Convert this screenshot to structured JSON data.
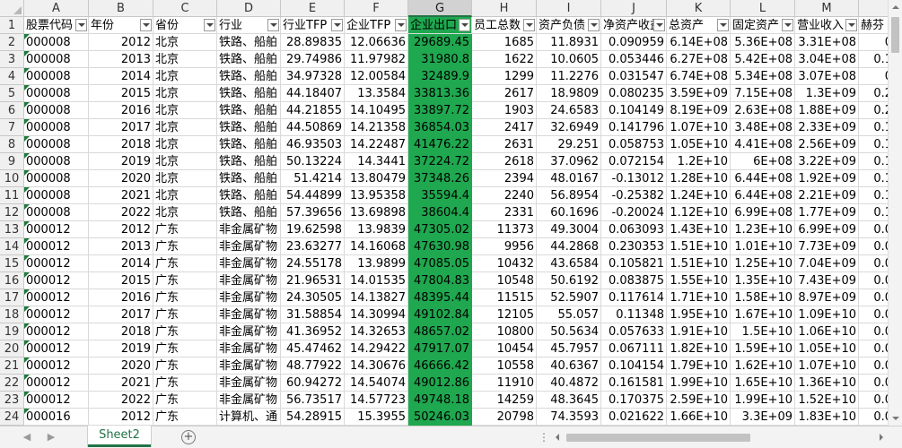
{
  "columns": [
    "A",
    "B",
    "C",
    "D",
    "E",
    "F",
    "G",
    "H",
    "I",
    "J",
    "K",
    "L",
    "M",
    ""
  ],
  "selected_column": "G",
  "headers": [
    "股票代码",
    "年份",
    "省份",
    "行业",
    "行业TFP",
    "企业TFP",
    "企业出口",
    "员工总数",
    "资产负债",
    "净资产收益",
    "总资产",
    "固定资产",
    "营业收入",
    "赫芬"
  ],
  "rows": [
    {
      "n": "2",
      "v": [
        "000008",
        "2012",
        "北京",
        "铁路、船舶",
        "28.89835",
        "12.06636",
        "29689.45",
        "1685",
        "11.8931",
        "0.090959",
        "6.14E+08",
        "5.36E+08",
        "3.31E+08",
        "0"
      ]
    },
    {
      "n": "3",
      "v": [
        "000008",
        "2013",
        "北京",
        "铁路、船舶",
        "29.74986",
        "11.97982",
        "31980.8",
        "1622",
        "10.0605",
        "0.053446",
        "6.27E+08",
        "5.42E+08",
        "3.04E+08",
        "0.1"
      ]
    },
    {
      "n": "4",
      "v": [
        "000008",
        "2014",
        "北京",
        "铁路、船舶",
        "34.97328",
        "12.00584",
        "32489.9",
        "1299",
        "11.2276",
        "0.031547",
        "6.74E+08",
        "5.34E+08",
        "3.07E+08",
        "0"
      ]
    },
    {
      "n": "5",
      "v": [
        "000008",
        "2015",
        "北京",
        "铁路、船舶",
        "44.18407",
        "13.3584",
        "33813.36",
        "2617",
        "18.9809",
        "0.080235",
        "3.59E+09",
        "7.15E+08",
        "1.3E+09",
        "0.2"
      ]
    },
    {
      "n": "6",
      "v": [
        "000008",
        "2016",
        "北京",
        "铁路、船舶",
        "44.21855",
        "14.10495",
        "33897.72",
        "1903",
        "24.6583",
        "0.104149",
        "8.19E+09",
        "2.63E+08",
        "1.88E+09",
        "0.2"
      ]
    },
    {
      "n": "7",
      "v": [
        "000008",
        "2017",
        "北京",
        "铁路、船舶",
        "44.50869",
        "14.21358",
        "36854.03",
        "2417",
        "32.6949",
        "0.141796",
        "1.07E+10",
        "3.48E+08",
        "2.33E+09",
        "0.1"
      ]
    },
    {
      "n": "8",
      "v": [
        "000008",
        "2018",
        "北京",
        "铁路、船舶",
        "46.93503",
        "14.22487",
        "41476.22",
        "2631",
        "29.251",
        "0.058753",
        "1.05E+10",
        "4.41E+08",
        "2.56E+09",
        "0.1"
      ]
    },
    {
      "n": "9",
      "v": [
        "000008",
        "2019",
        "北京",
        "铁路、船舶",
        "50.13224",
        "14.3441",
        "37224.72",
        "2618",
        "37.0962",
        "0.072154",
        "1.2E+10",
        "6E+08",
        "3.22E+09",
        "0.1"
      ]
    },
    {
      "n": "10",
      "v": [
        "000008",
        "2020",
        "北京",
        "铁路、船舶",
        "51.4214",
        "13.80479",
        "37348.26",
        "2394",
        "48.0167",
        "-0.13012",
        "1.28E+10",
        "6.44E+08",
        "1.92E+09",
        "0.1"
      ]
    },
    {
      "n": "11",
      "v": [
        "000008",
        "2021",
        "北京",
        "铁路、船舶",
        "54.44899",
        "13.95358",
        "35594.4",
        "2240",
        "56.8954",
        "-0.25382",
        "1.24E+10",
        "6.44E+08",
        "2.21E+09",
        "0.1"
      ]
    },
    {
      "n": "12",
      "v": [
        "000008",
        "2022",
        "北京",
        "铁路、船舶",
        "57.39656",
        "13.69898",
        "38604.4",
        "2331",
        "60.1696",
        "-0.20024",
        "1.12E+10",
        "6.99E+08",
        "1.77E+09",
        "0.1"
      ]
    },
    {
      "n": "13",
      "v": [
        "000012",
        "2012",
        "广东",
        "非金属矿物",
        "19.62598",
        "13.9839",
        "47305.02",
        "11373",
        "49.3004",
        "0.063093",
        "1.43E+10",
        "1.23E+10",
        "6.99E+09",
        "0.0"
      ]
    },
    {
      "n": "14",
      "v": [
        "000012",
        "2013",
        "广东",
        "非金属矿物",
        "23.63277",
        "14.16068",
        "47630.98",
        "9956",
        "44.2868",
        "0.230353",
        "1.51E+10",
        "1.01E+10",
        "7.73E+09",
        "0.0"
      ]
    },
    {
      "n": "15",
      "v": [
        "000012",
        "2014",
        "广东",
        "非金属矿物",
        "24.55178",
        "13.9899",
        "47085.05",
        "10432",
        "43.6584",
        "0.105821",
        "1.51E+10",
        "1.25E+10",
        "7.04E+09",
        "0.0"
      ]
    },
    {
      "n": "16",
      "v": [
        "000012",
        "2015",
        "广东",
        "非金属矿物",
        "21.96531",
        "14.01535",
        "47804.83",
        "10548",
        "50.6192",
        "0.083875",
        "1.55E+10",
        "1.35E+10",
        "7.43E+09",
        "0.0"
      ]
    },
    {
      "n": "17",
      "v": [
        "000012",
        "2016",
        "广东",
        "非金属矿物",
        "24.30505",
        "14.13827",
        "48395.44",
        "11515",
        "52.5907",
        "0.117614",
        "1.71E+10",
        "1.58E+10",
        "8.97E+09",
        "0.0"
      ]
    },
    {
      "n": "18",
      "v": [
        "000012",
        "2017",
        "广东",
        "非金属矿物",
        "31.58854",
        "14.30994",
        "49102.84",
        "12105",
        "55.057",
        "0.11348",
        "1.95E+10",
        "1.67E+10",
        "1.09E+10",
        "0.0"
      ]
    },
    {
      "n": "19",
      "v": [
        "000012",
        "2018",
        "广东",
        "非金属矿物",
        "41.36952",
        "14.32653",
        "48657.02",
        "10800",
        "50.5634",
        "0.057633",
        "1.91E+10",
        "1.5E+10",
        "1.06E+10",
        "0.0"
      ]
    },
    {
      "n": "20",
      "v": [
        "000012",
        "2019",
        "广东",
        "非金属矿物",
        "45.47462",
        "14.29422",
        "47917.07",
        "10454",
        "45.7957",
        "0.067111",
        "1.82E+10",
        "1.59E+10",
        "1.05E+10",
        "0.0"
      ]
    },
    {
      "n": "21",
      "v": [
        "000012",
        "2020",
        "广东",
        "非金属矿物",
        "48.77922",
        "14.30676",
        "46666.42",
        "10558",
        "40.6367",
        "0.104154",
        "1.79E+10",
        "1.62E+10",
        "1.07E+10",
        "0.0"
      ]
    },
    {
      "n": "22",
      "v": [
        "000012",
        "2021",
        "广东",
        "非金属矿物",
        "60.94272",
        "14.54074",
        "49012.86",
        "11910",
        "40.4872",
        "0.161581",
        "1.99E+10",
        "1.65E+10",
        "1.36E+10",
        "0.0"
      ]
    },
    {
      "n": "23",
      "v": [
        "000012",
        "2022",
        "广东",
        "非金属矿物",
        "56.73517",
        "14.57723",
        "49748.18",
        "14259",
        "48.3645",
        "0.170375",
        "2.59E+10",
        "1.99E+10",
        "1.52E+10",
        "0.0"
      ]
    },
    {
      "n": "24",
      "v": [
        "000016",
        "2012",
        "广东",
        "计算机、通",
        "54.28915",
        "15.3955",
        "50246.03",
        "20798",
        "74.3593",
        "0.021622",
        "1.66E+10",
        "3.3E+09",
        "1.83E+10",
        "0.0"
      ]
    }
  ],
  "sheet_tab": "Sheet2",
  "add_sheet_icon": "+",
  "colors": {
    "highlight": "#1fa84f",
    "accent": "#217346"
  }
}
